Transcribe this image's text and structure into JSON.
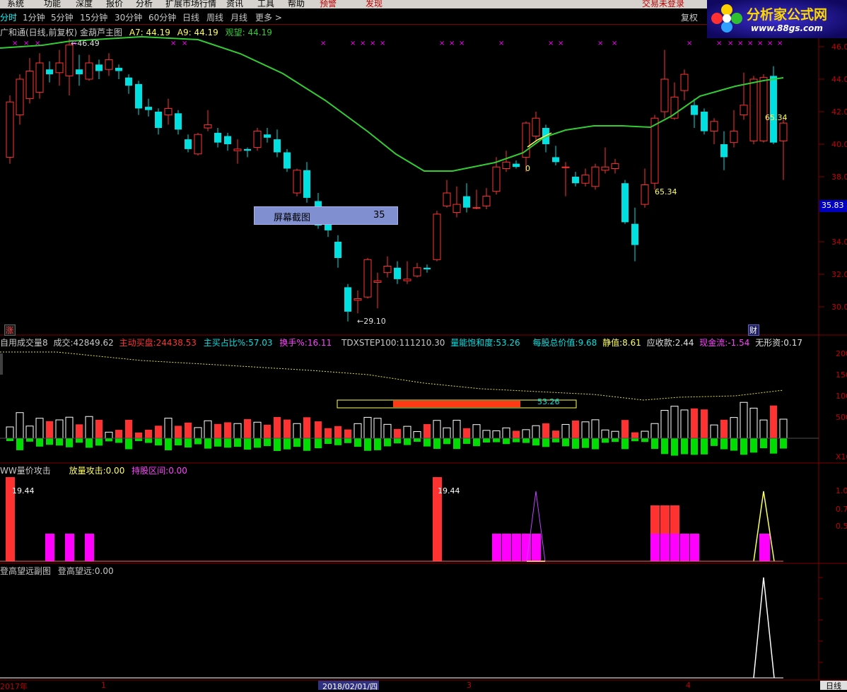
{
  "menu": [
    "系统",
    "功能",
    "深度",
    "报价",
    "分析",
    "扩展市场行情",
    "资讯",
    "工具",
    "帮助"
  ],
  "menu_extra": {
    "alert": "预警",
    "discover": "发现",
    "login": "交易未登录"
  },
  "periods": [
    "分时",
    "1分钟",
    "5分钟",
    "15分钟",
    "30分钟",
    "60分钟",
    "日线",
    "周线",
    "月线",
    "更多 >"
  ],
  "active_period": "分时",
  "restore_button": "复权",
  "logo": {
    "cn": "分析家公式网",
    "url": "www.88gs.com"
  },
  "main": {
    "stock_title": "广和通(日线,前复权) 金葫芦主图",
    "a7_label": "A7:",
    "a7": "44.19",
    "a9_label": "A9:",
    "a9": "44.19",
    "gw_label": "观望:",
    "gw": "44.19",
    "high_label": "46.49",
    "low_label": "29.10",
    "ann_0": "0",
    "ann_65a": "65.34",
    "ann_65b": "65.34",
    "price_tag": "35.83",
    "zhang_badge": "涨",
    "cai_badge": "财",
    "yticks": [
      "46.0",
      "44.0",
      "42.0",
      "40.0",
      "38.0",
      "36.0",
      "34.0",
      "32.0",
      "30.0"
    ],
    "tooltip": {
      "label": "屏幕截图",
      "value": "35"
    }
  },
  "volume": {
    "title": "自用成交量8",
    "chengjiao_label": "成交:",
    "chengjiao": "42849.62",
    "zhudong_label": "主动买盘:",
    "zhudong": "24438.53",
    "zhumai_label": "主买占比%:",
    "zhumai": "57.03",
    "huanshou_label": "换手%:",
    "huanshou": "16.11",
    "tdx_label": "TDXSTEP100:",
    "tdx": "111210.30",
    "baohe_label": "量能饱和度:",
    "baohe": "53.26",
    "zongjia_label": "每股总价值:",
    "zongjia": "9.68",
    "jing_label": "静值:",
    "jing": "8.61",
    "yingshou_label": "应收款:",
    "yingshou": "2.44",
    "xianjin_label": "现金流:",
    "xianjin": "-1.54",
    "wuxing_label": "无形资:",
    "wuxing": "0.17",
    "bar_value": "53.26",
    "yticks": [
      "2000",
      "1500",
      "1000",
      "500"
    ],
    "unit": "X10"
  },
  "ind1": {
    "title": "WW量价攻击",
    "fl_label": "放量攻击:",
    "fl": "0.00",
    "cg_label": "持股区间:",
    "cg": "0.00",
    "val_a": "19.44",
    "val_b": "19.44",
    "yticks": [
      "1.0",
      "0.7",
      "0.5"
    ]
  },
  "ind2": {
    "title": "登高望远副图",
    "dg_label": "登高望远:",
    "dg": "0.00"
  },
  "xaxis": {
    "label_a": "2017年",
    "label_b": "1",
    "label_c": "2018/02/01/四",
    "label_d": "3",
    "label_e": "4",
    "corner": "日线"
  },
  "colors": {
    "up": "#ff3232",
    "down": "#00e0e0",
    "ma": "#33cc33",
    "volume_down": "#00dd00",
    "magenta": "#ff00ff"
  }
}
